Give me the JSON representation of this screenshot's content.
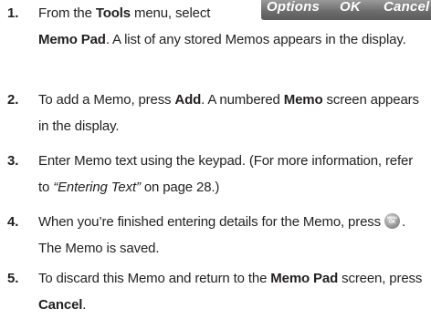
{
  "softkeys": {
    "options": "Options",
    "ok": "OK",
    "cancel": "Cancel"
  },
  "steps": [
    {
      "number": "1.",
      "parts": [
        {
          "text": "From the "
        },
        {
          "text": "Tools",
          "bold": true
        },
        {
          "text": " menu, select"
        },
        {
          "break": true
        },
        {
          "text": "Memo Pad",
          "bold": true
        },
        {
          "text": ". A list of any stored Memos appears in the display."
        }
      ]
    },
    {
      "number": "2.",
      "parts": [
        {
          "text": "To add a Memo, press "
        },
        {
          "text": "Add",
          "bold": true
        },
        {
          "text": ". A numbered "
        },
        {
          "text": "Memo",
          "bold": true
        },
        {
          "text": " screen appears in the display."
        }
      ]
    },
    {
      "number": "3.",
      "parts": [
        {
          "text": "Enter Memo text using the keypad. (For more information, refer to "
        },
        {
          "text": "“Entering Text”",
          "italic": true
        },
        {
          "text": "  on page 28.)"
        }
      ]
    },
    {
      "number": "4.",
      "parts": [
        {
          "text": "When you’re finished entering details for the Memo, press "
        },
        {
          "icon": "menu-ok-icon"
        },
        {
          "text": ". The Memo is saved."
        }
      ]
    },
    {
      "number": "5.",
      "parts": [
        {
          "text": "To discard this Memo and return to the "
        },
        {
          "text": "Memo Pad",
          "bold": true
        },
        {
          "text": " screen, press "
        },
        {
          "text": "Cancel",
          "bold": true
        },
        {
          "text": "."
        }
      ]
    }
  ]
}
